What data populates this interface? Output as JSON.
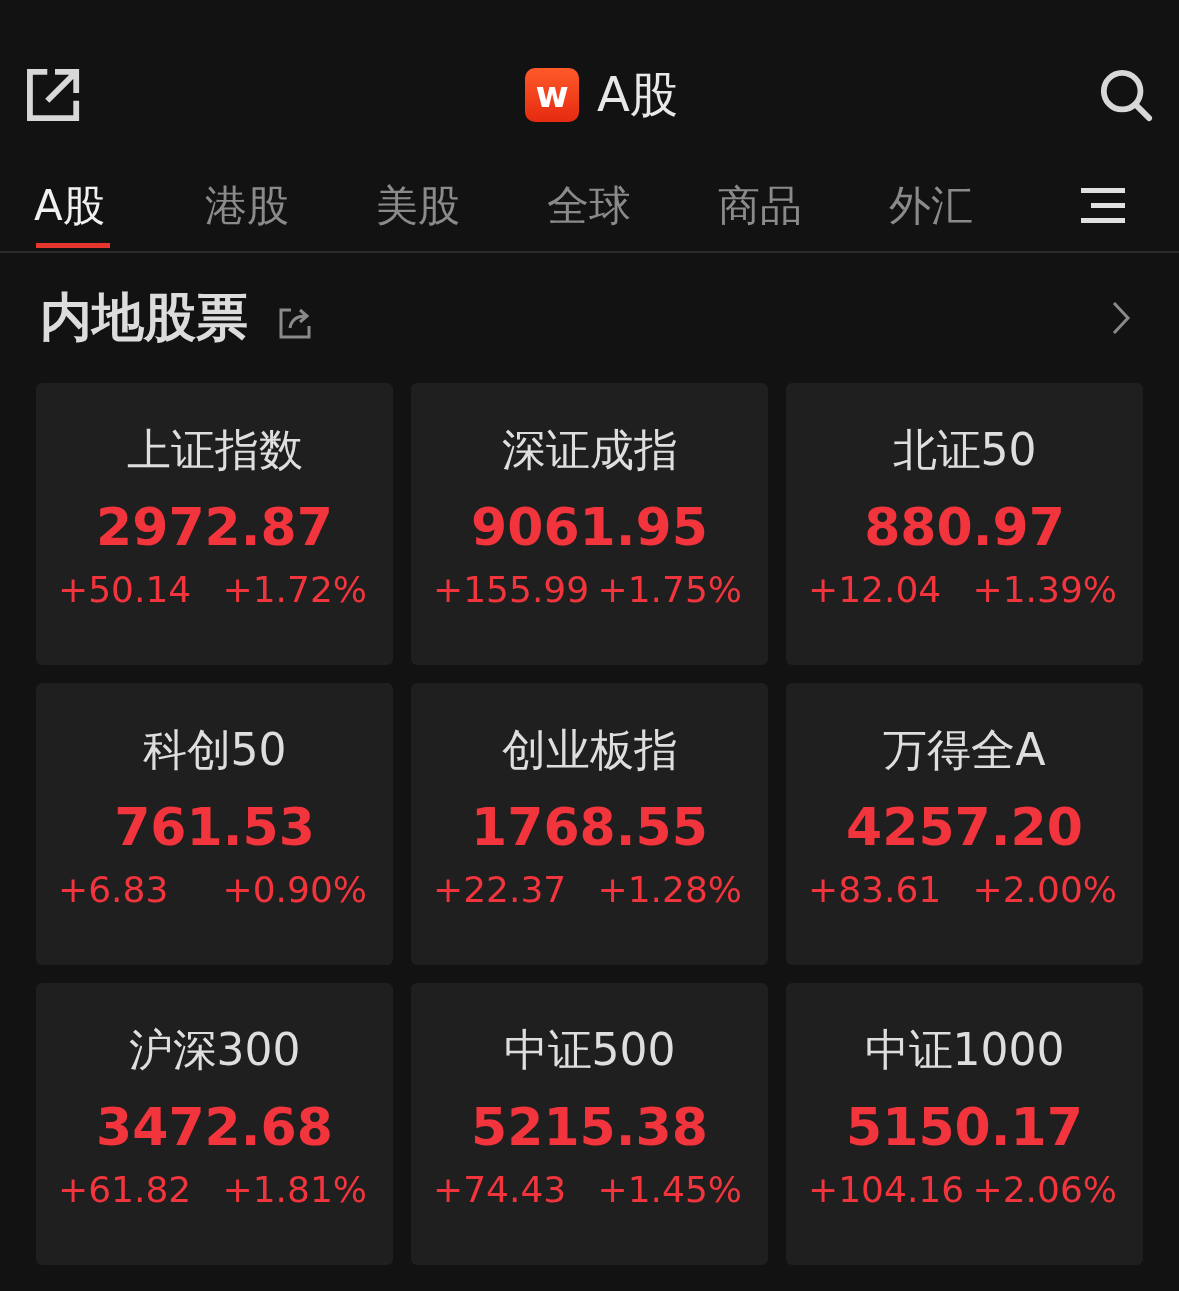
{
  "header": {
    "logo_text": "w",
    "title": "A股"
  },
  "tabs": [
    {
      "label": "A股",
      "selected": true
    },
    {
      "label": "港股",
      "selected": false
    },
    {
      "label": "美股",
      "selected": false
    },
    {
      "label": "全球",
      "selected": false
    },
    {
      "label": "商品",
      "selected": false
    },
    {
      "label": "外汇",
      "selected": false
    }
  ],
  "section": {
    "title": "内地股票"
  },
  "indices": [
    {
      "name": "上证指数",
      "value": "2972.87",
      "change": "+50.14",
      "percent": "+1.72%"
    },
    {
      "name": "深证成指",
      "value": "9061.95",
      "change": "+155.99",
      "percent": "+1.75%"
    },
    {
      "name": "北证50",
      "value": "880.97",
      "change": "+12.04",
      "percent": "+1.39%"
    },
    {
      "name": "科创50",
      "value": "761.53",
      "change": "+6.83",
      "percent": "+0.90%"
    },
    {
      "name": "创业板指",
      "value": "1768.55",
      "change": "+22.37",
      "percent": "+1.28%"
    },
    {
      "name": "万得全A",
      "value": "4257.20",
      "change": "+83.61",
      "percent": "+2.00%"
    },
    {
      "name": "沪深300",
      "value": "3472.68",
      "change": "+61.82",
      "percent": "+1.81%"
    },
    {
      "name": "中证500",
      "value": "5215.38",
      "change": "+74.43",
      "percent": "+1.45%"
    },
    {
      "name": "中证1000",
      "value": "5150.17",
      "change": "+104.16",
      "percent": "+2.06%"
    }
  ]
}
